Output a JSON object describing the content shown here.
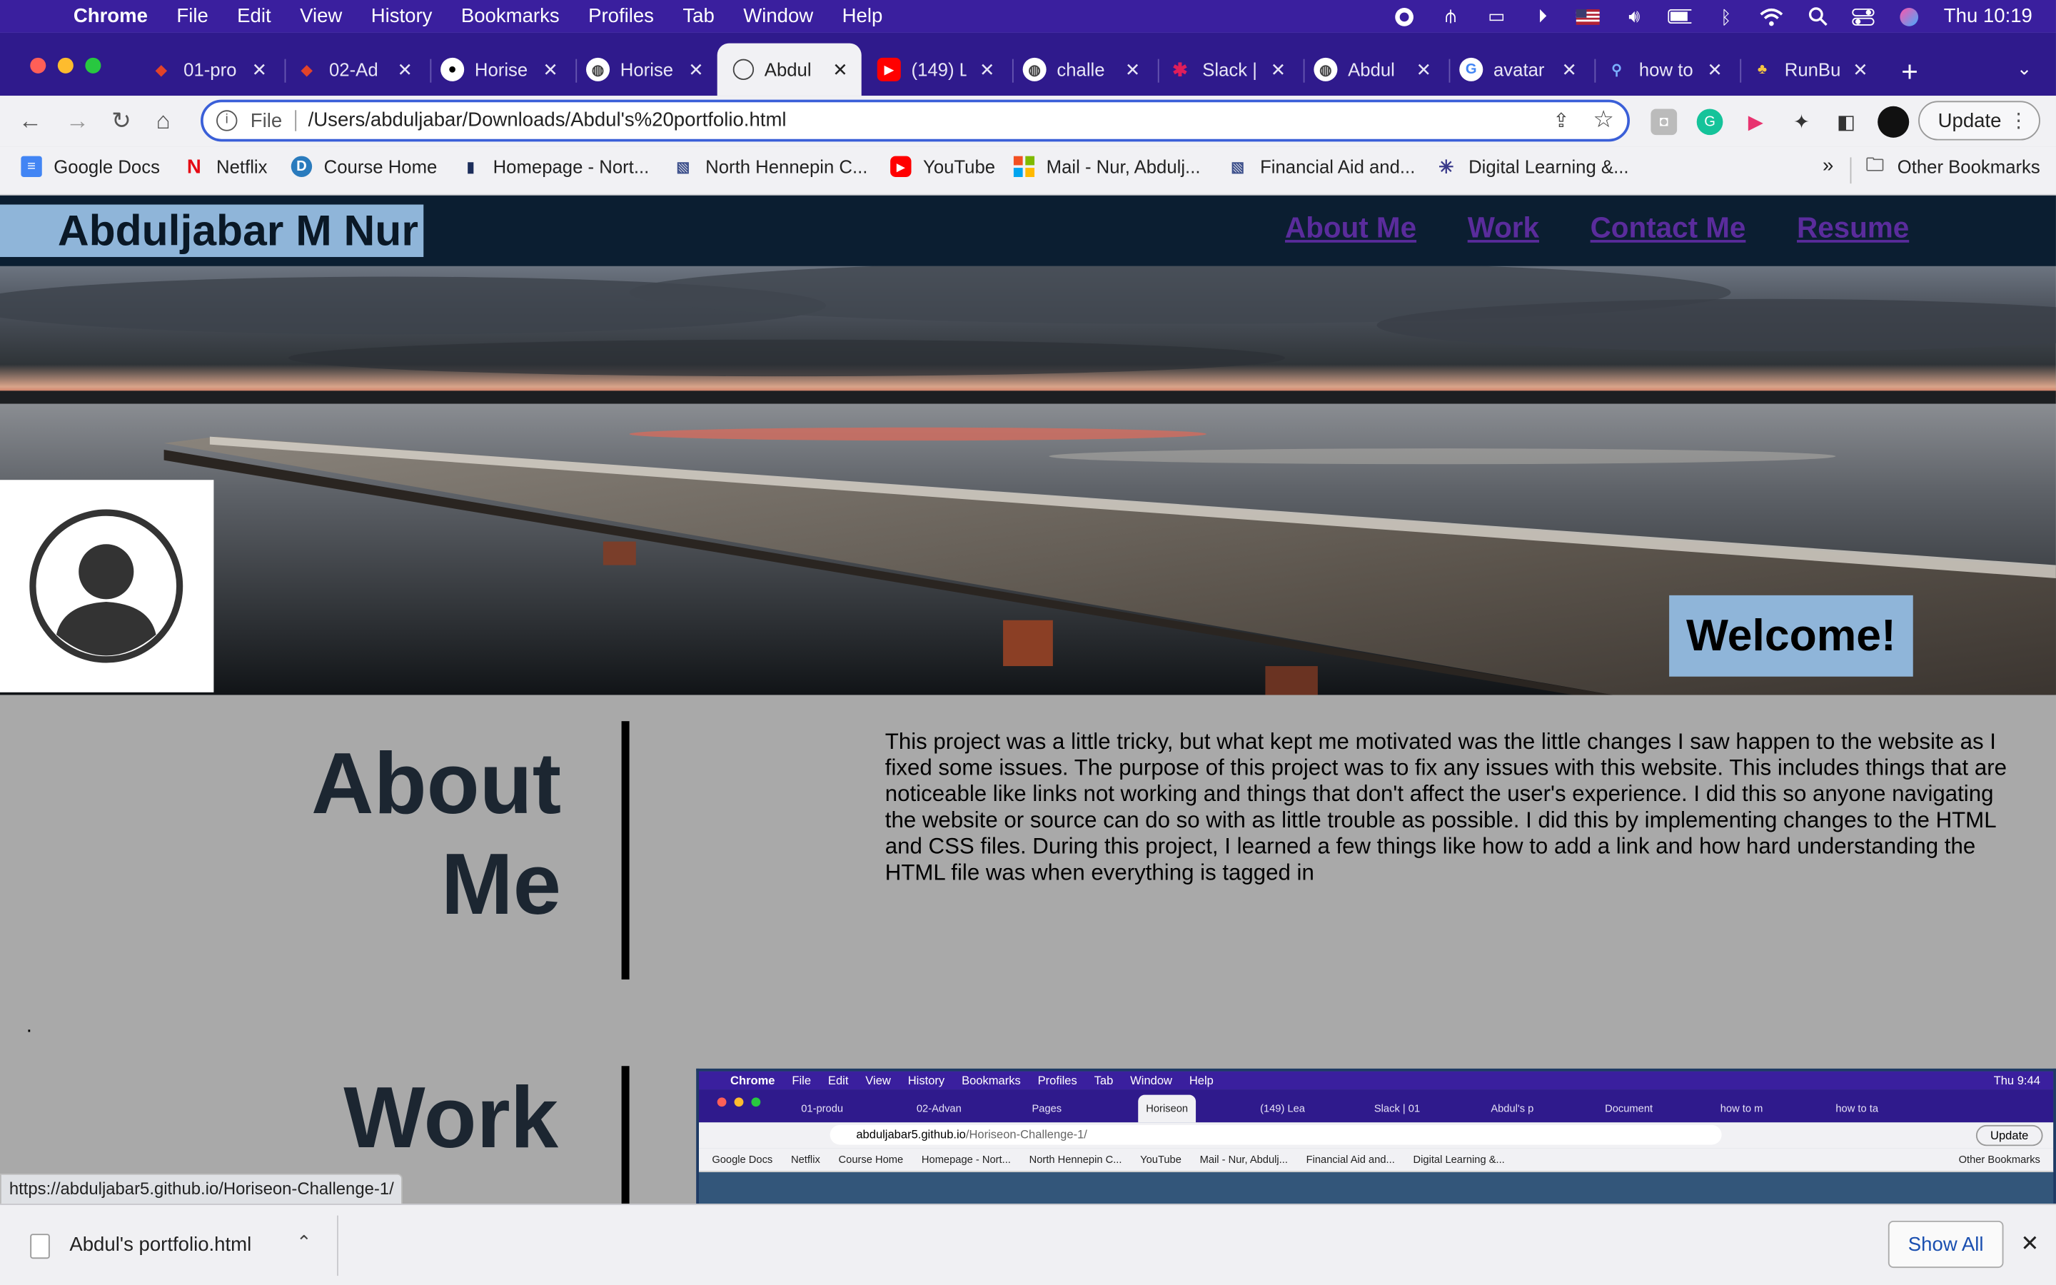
{
  "menubar": {
    "app": "Chrome",
    "items": [
      "File",
      "Edit",
      "View",
      "History",
      "Bookmarks",
      "Profiles",
      "Tab",
      "Window",
      "Help"
    ],
    "clock": "Thu 10:19"
  },
  "tabs": [
    {
      "title": "01-pro",
      "icon": "gitlab-icon"
    },
    {
      "title": "02-Ad",
      "icon": "gitlab-icon"
    },
    {
      "title": "Horise",
      "icon": "github-icon"
    },
    {
      "title": "Horise",
      "icon": "globe-icon"
    },
    {
      "title": "Abdul",
      "icon": "globe-icon",
      "active": true
    },
    {
      "title": "(149) L",
      "icon": "youtube-icon"
    },
    {
      "title": "challe",
      "icon": "globe-icon"
    },
    {
      "title": "Slack |",
      "icon": "slack-icon"
    },
    {
      "title": "Abdul",
      "icon": "globe-icon"
    },
    {
      "title": "avatar",
      "icon": "google-icon"
    },
    {
      "title": "how to",
      "icon": "search-icon"
    },
    {
      "title": "RunBu",
      "icon": "runbuddy-icon"
    }
  ],
  "omnibox": {
    "scheme": "File",
    "url": "/Users/abduljabar/Downloads/Abdul's%20portfolio.html"
  },
  "toolbar": {
    "update_label": "Update"
  },
  "bookmarks": {
    "items": [
      {
        "label": "Google Docs",
        "icon": "google-docs-icon"
      },
      {
        "label": "Netflix",
        "icon": "netflix-icon"
      },
      {
        "label": "Course Home",
        "icon": "course-icon"
      },
      {
        "label": "Homepage - Nort...",
        "icon": "bookmark-icon"
      },
      {
        "label": "North Hennepin C...",
        "icon": "college-icon"
      },
      {
        "label": "YouTube",
        "icon": "youtube-icon"
      },
      {
        "label": "Mail - Nur, Abdulj...",
        "icon": "microsoft-icon"
      },
      {
        "label": "Financial Aid and...",
        "icon": "college-icon"
      },
      {
        "label": "Digital Learning &...",
        "icon": "digital-learning-icon"
      }
    ],
    "other": "Other Bookmarks"
  },
  "site": {
    "name": "Abduljabar M Nur",
    "nav": [
      "About Me",
      "Work",
      "Contact Me",
      "Resume"
    ],
    "welcome": "Welcome!",
    "about_title_line1": "About",
    "about_title_line2": "Me",
    "about_text": "This project was a little tricky, but what kept me motivated was the little changes I saw happen to the website as I fixed some issues. The purpose of this project was to fix any issues with this website. This includes things that are noticeable like links not working and things that don't affect the user's experience. I did this so anyone navigating the website or source can do so with as little trouble as possible. I did this by implementing changes to the HTML and CSS files. During this project, I learned a few things like how to add a link and how hard understanding the HTML file was when everything is tagged in",
    "stray": ".",
    "work_title": "Work"
  },
  "work_screenshot": {
    "menubar": [
      "Chrome",
      "File",
      "Edit",
      "View",
      "History",
      "Bookmarks",
      "Profiles",
      "Tab",
      "Window",
      "Help"
    ],
    "clock": "Thu 9:44",
    "tabs": [
      "01-produ",
      "02-Advan",
      "Pages",
      "Horiseon",
      "(149) Lea",
      "Slack | 01",
      "Abdul's p",
      "Document",
      "how to m",
      "how to ta"
    ],
    "url_host": "abduljabar5.github.io",
    "url_path": "/Horiseon-Challenge-1/",
    "update_label": "Update",
    "bookmarks": [
      "Google Docs",
      "Netflix",
      "Course Home",
      "Homepage - Nort...",
      "North Hennepin C...",
      "YouTube",
      "Mail - Nur, Abdulj...",
      "Financial Aid and...",
      "Digital Learning &..."
    ],
    "other": "Other Bookmarks"
  },
  "status_url": "https://abduljabar5.github.io/Horiseon-Challenge-1/",
  "download": {
    "filename": "Abdul's portfolio.html",
    "show_all": "Show All"
  },
  "colors": {
    "menubar": "#3a1f9e",
    "header_bg": "#0b1e31",
    "accent_blue": "#8fb5d9",
    "nav_link": "#5a2c9c",
    "page_bg": "#a9a9a9"
  }
}
